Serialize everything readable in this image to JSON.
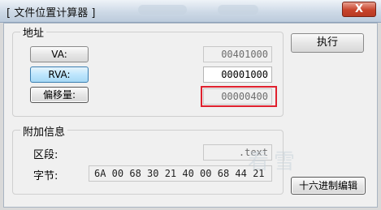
{
  "window": {
    "title": "[ 文件位置计算器 ]",
    "close_glyph": "X"
  },
  "address_group": {
    "title": "地址",
    "va": {
      "button": "VA:",
      "value": "00401000"
    },
    "rva": {
      "button": "RVA:",
      "value": "00001000"
    },
    "offset": {
      "button": "偏移量:",
      "value": "00000400"
    }
  },
  "execute_button": "执行",
  "info_group": {
    "title": "附加信息",
    "section_label": "区段:",
    "section_value": ".text",
    "bytes_label": "字节:",
    "bytes_value": "6A 00 68 30 21 40 00 68 44 21"
  },
  "hex_edit_button": "十六进制编辑",
  "watermark": "看雪",
  "colors": {
    "highlight": "#e0212e",
    "focused_button": "#bee6fd"
  }
}
